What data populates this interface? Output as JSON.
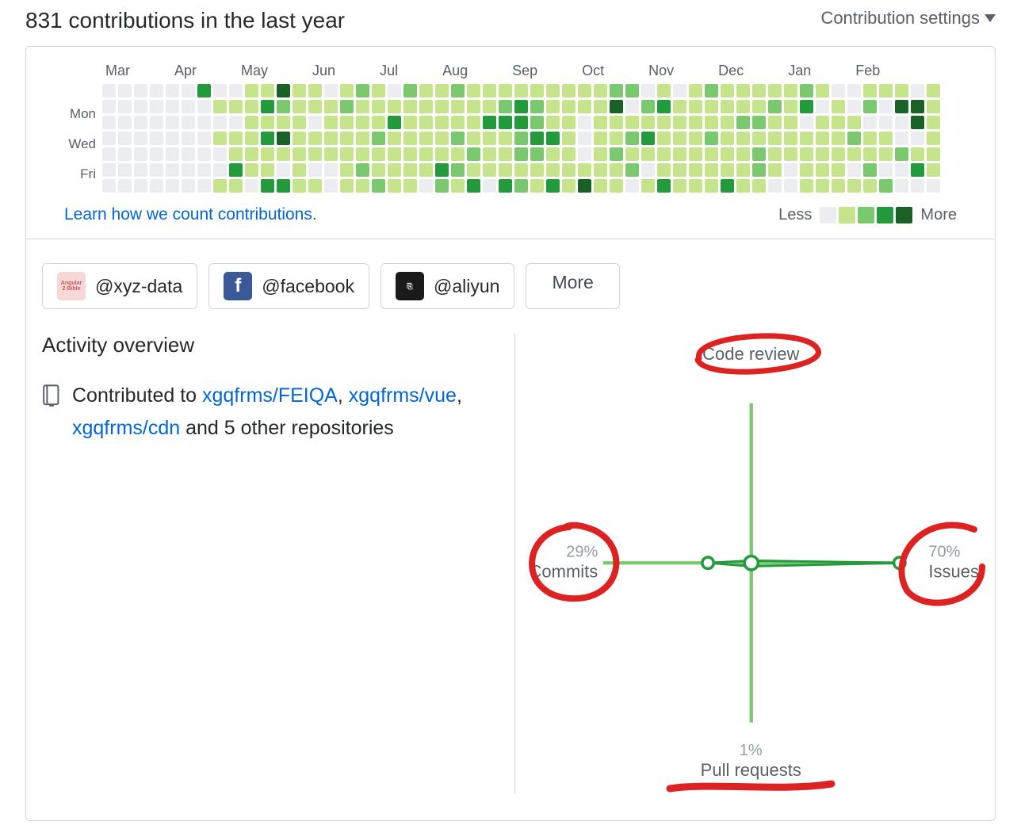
{
  "header": {
    "title": "831 contributions in the last year",
    "settings_label": "Contribution settings"
  },
  "calendar": {
    "months": [
      "Mar",
      "Apr",
      "May",
      "Jun",
      "Jul",
      "Aug",
      "Sep",
      "Oct",
      "Nov",
      "Dec",
      "Jan",
      "Feb"
    ],
    "day_labels": [
      "Mon",
      "Wed",
      "Fri"
    ],
    "weeks": [
      [
        0,
        0,
        0,
        0,
        0,
        0,
        0
      ],
      [
        0,
        0,
        0,
        0,
        0,
        0,
        0
      ],
      [
        0,
        0,
        0,
        0,
        0,
        0,
        0
      ],
      [
        0,
        0,
        0,
        0,
        0,
        0,
        0
      ],
      [
        0,
        0,
        0,
        0,
        0,
        0,
        0
      ],
      [
        0,
        0,
        0,
        0,
        0,
        0,
        0
      ],
      [
        3,
        0,
        0,
        0,
        0,
        0,
        0
      ],
      [
        0,
        1,
        0,
        1,
        0,
        0,
        1
      ],
      [
        0,
        1,
        0,
        1,
        1,
        3,
        1
      ],
      [
        1,
        1,
        1,
        1,
        1,
        1,
        0
      ],
      [
        1,
        3,
        1,
        3,
        1,
        1,
        3
      ],
      [
        4,
        2,
        1,
        4,
        1,
        0,
        3
      ],
      [
        1,
        1,
        1,
        1,
        1,
        1,
        1
      ],
      [
        1,
        1,
        0,
        1,
        1,
        0,
        1
      ],
      [
        0,
        1,
        1,
        1,
        1,
        0,
        0
      ],
      [
        1,
        2,
        1,
        1,
        1,
        1,
        1
      ],
      [
        2,
        1,
        1,
        1,
        1,
        2,
        1
      ],
      [
        1,
        1,
        1,
        2,
        1,
        1,
        2
      ],
      [
        0,
        1,
        3,
        1,
        1,
        1,
        1
      ],
      [
        2,
        1,
        1,
        1,
        1,
        1,
        1
      ],
      [
        1,
        1,
        1,
        1,
        1,
        1,
        0
      ],
      [
        1,
        1,
        1,
        1,
        1,
        3,
        2
      ],
      [
        2,
        1,
        1,
        2,
        1,
        2,
        1
      ],
      [
        1,
        1,
        1,
        1,
        2,
        1,
        3
      ],
      [
        1,
        1,
        3,
        1,
        1,
        1,
        0
      ],
      [
        1,
        2,
        3,
        1,
        1,
        1,
        3
      ],
      [
        1,
        3,
        3,
        2,
        2,
        1,
        2
      ],
      [
        1,
        2,
        2,
        3,
        2,
        1,
        1
      ],
      [
        1,
        1,
        1,
        3,
        1,
        1,
        3
      ],
      [
        1,
        1,
        1,
        1,
        1,
        1,
        1
      ],
      [
        1,
        1,
        0,
        0,
        0,
        1,
        4
      ],
      [
        1,
        1,
        1,
        1,
        1,
        1,
        1
      ],
      [
        2,
        4,
        1,
        1,
        2,
        1,
        1
      ],
      [
        2,
        0,
        1,
        2,
        1,
        2,
        0
      ],
      [
        0,
        2,
        1,
        3,
        1,
        0,
        1
      ],
      [
        1,
        3,
        1,
        1,
        1,
        1,
        3
      ],
      [
        0,
        1,
        1,
        1,
        1,
        1,
        1
      ],
      [
        1,
        1,
        1,
        1,
        1,
        1,
        1
      ],
      [
        2,
        1,
        1,
        2,
        1,
        1,
        1
      ],
      [
        1,
        1,
        1,
        1,
        1,
        1,
        3
      ],
      [
        1,
        1,
        2,
        1,
        1,
        1,
        1
      ],
      [
        1,
        1,
        2,
        1,
        2,
        2,
        1
      ],
      [
        1,
        2,
        1,
        1,
        1,
        1,
        0
      ],
      [
        1,
        1,
        1,
        1,
        1,
        0,
        0
      ],
      [
        2,
        3,
        0,
        1,
        1,
        1,
        1
      ],
      [
        1,
        0,
        1,
        1,
        1,
        1,
        1
      ],
      [
        0,
        1,
        1,
        1,
        1,
        1,
        1
      ],
      [
        0,
        0,
        1,
        2,
        1,
        0,
        1
      ],
      [
        1,
        2,
        0,
        1,
        1,
        2,
        1
      ],
      [
        1,
        0,
        0,
        1,
        1,
        0,
        2
      ],
      [
        1,
        4,
        0,
        0,
        2,
        0,
        0
      ],
      [
        0,
        4,
        4,
        0,
        1,
        3,
        0
      ],
      [
        1,
        1,
        1,
        1,
        1,
        1,
        0
      ]
    ],
    "learn_link": "Learn how we count contributions.",
    "legend": {
      "less": "Less",
      "more": "More"
    }
  },
  "orgs": {
    "items": [
      {
        "handle": "@xyz-data",
        "icon": "xyz"
      },
      {
        "handle": "@facebook",
        "icon": "fb"
      },
      {
        "handle": "@aliyun",
        "icon": "ali"
      }
    ],
    "more_label": "More"
  },
  "activity": {
    "heading": "Activity overview",
    "contrib_prefix": "Contributed to ",
    "repos": [
      {
        "name": "xgqfrms/FEIQA"
      },
      {
        "name": "xgqfrms/vue"
      },
      {
        "name": "xgqfrms/cdn"
      }
    ],
    "suffix": "and 5 other repositories"
  },
  "radar": {
    "axes": {
      "top": {
        "label": "Code review",
        "pct": ""
      },
      "right": {
        "label": "Issues",
        "pct": "70%"
      },
      "bottom": {
        "label": "Pull requests",
        "pct": "1%"
      },
      "left": {
        "label": "Commits",
        "pct": "29%"
      }
    }
  },
  "annotations": {
    "circle_color": "#d22",
    "stroke_width": 6
  }
}
